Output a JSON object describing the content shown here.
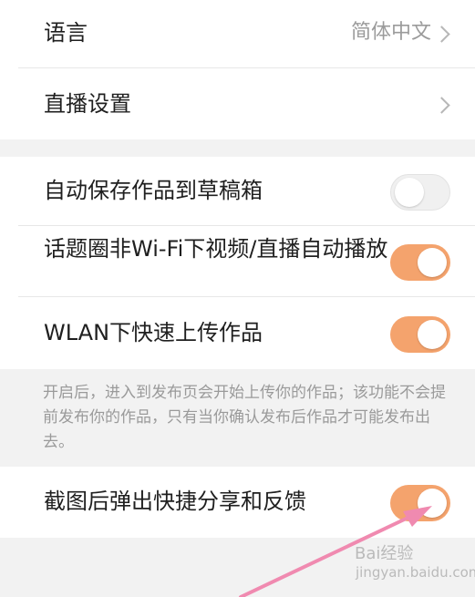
{
  "settings": {
    "language": {
      "label": "语言",
      "value": "简体中文"
    },
    "live_settings": {
      "label": "直播设置"
    },
    "auto_save": {
      "label": "自动保存作品到草稿箱",
      "enabled": false
    },
    "topic_autoplay": {
      "label": "话题圈非Wi-Fi下视频/直播自动播放",
      "enabled": true
    },
    "wlan_upload": {
      "label": "WLAN下快速上传作品",
      "enabled": true
    },
    "wlan_upload_note": "开启后，进入到发布页会开始上传你的作品；该功能不会提前发布你的作品，只有当你确认发布后作品才可能发布出去。",
    "screenshot_share": {
      "label": "截图后弹出快捷分享和反馈",
      "enabled": true
    }
  },
  "watermark": {
    "brand": "Bai",
    "brand_tail": "经验",
    "sub": "jingyan.baidu.com"
  },
  "colors": {
    "accent": "#f4a36d",
    "annotation_arrow": "#f08ab0"
  }
}
